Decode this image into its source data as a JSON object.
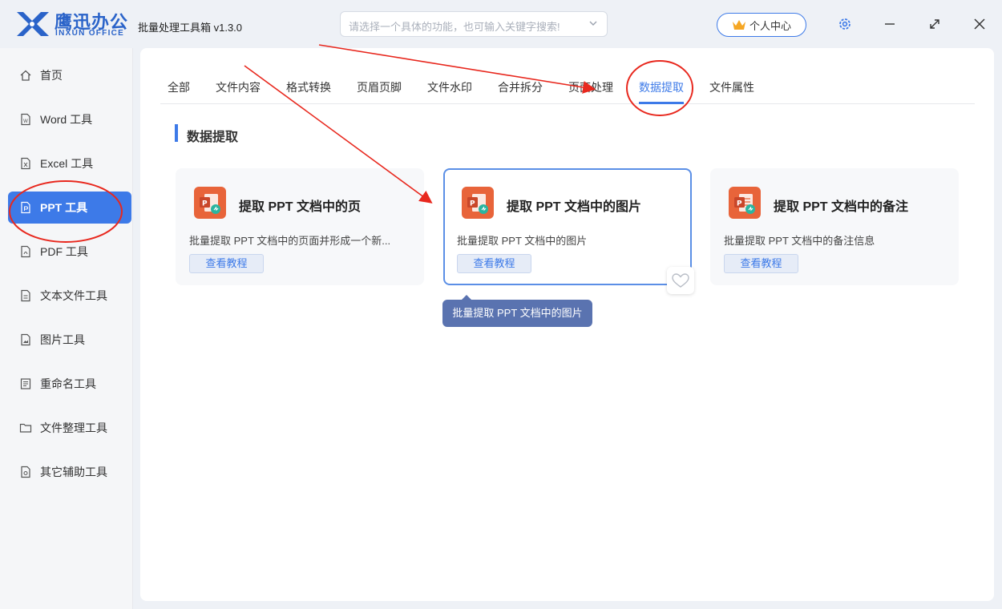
{
  "app": {
    "brand_cn": "鹰迅办公",
    "brand_en": "INXUN OFFICE",
    "title": "批量处理工具箱 v1.3.0"
  },
  "search": {
    "placeholder": "请选择一个具体的功能，也可输入关键字搜索!"
  },
  "header": {
    "user_center": "个人中心"
  },
  "sidebar": {
    "items": [
      {
        "label": "首页",
        "icon": "home-icon"
      },
      {
        "label": "Word 工具",
        "icon": "word-file-icon"
      },
      {
        "label": "Excel 工具",
        "icon": "excel-file-icon"
      },
      {
        "label": "PPT 工具",
        "icon": "ppt-file-icon",
        "active": true
      },
      {
        "label": "PDF 工具",
        "icon": "pdf-file-icon"
      },
      {
        "label": "文本文件工具",
        "icon": "text-file-icon"
      },
      {
        "label": "图片工具",
        "icon": "image-file-icon"
      },
      {
        "label": "重命名工具",
        "icon": "rename-icon"
      },
      {
        "label": "文件整理工具",
        "icon": "folder-icon"
      },
      {
        "label": "其它辅助工具",
        "icon": "misc-tool-icon"
      }
    ]
  },
  "tabs": [
    {
      "label": "全部"
    },
    {
      "label": "文件内容"
    },
    {
      "label": "格式转换"
    },
    {
      "label": "页眉页脚"
    },
    {
      "label": "文件水印"
    },
    {
      "label": "合并拆分"
    },
    {
      "label": "页面处理"
    },
    {
      "label": "数据提取",
      "active": true
    },
    {
      "label": "文件属性"
    }
  ],
  "section": {
    "title": "数据提取"
  },
  "cards": [
    {
      "title": "提取 PPT 文档中的页",
      "desc": "批量提取 PPT 文档中的页面并形成一个新...",
      "button": "查看教程"
    },
    {
      "title": "提取 PPT 文档中的图片",
      "desc": "批量提取 PPT 文档中的图片",
      "button": "查看教程"
    },
    {
      "title": "提取 PPT 文档中的备注",
      "desc": "批量提取 PPT 文档中的备注信息",
      "button": "查看教程"
    }
  ],
  "tooltip": "批量提取 PPT 文档中的图片",
  "colors": {
    "accent": "#3d7ae8",
    "ppt_orange": "#e8643a",
    "annotation_red": "#e8281e"
  }
}
